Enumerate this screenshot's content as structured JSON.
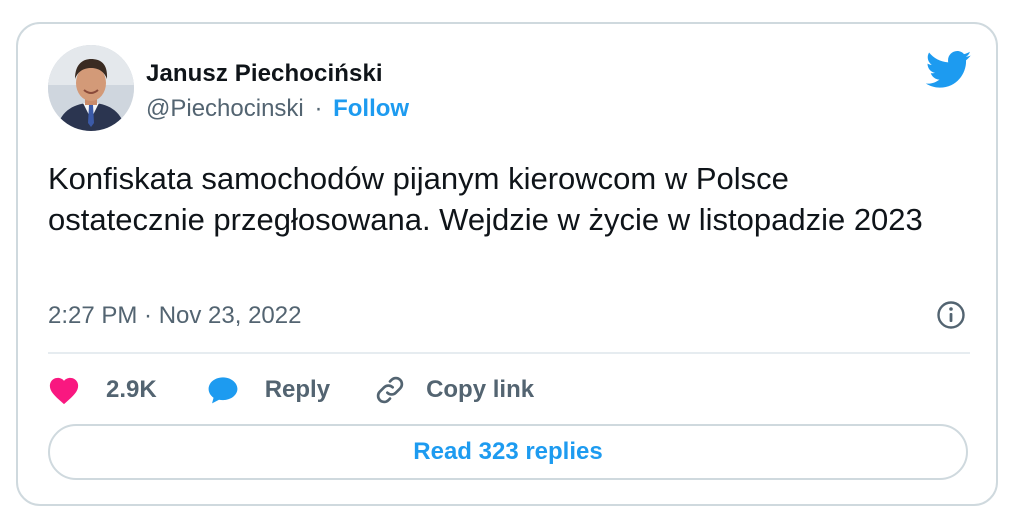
{
  "author": {
    "name": "Janusz Piechociński",
    "handle": "@Piechocinski",
    "separator": "·",
    "follow_label": "Follow"
  },
  "tweet": {
    "text": "Konfiskata samochodów pijanym kierowcom w Polsce ostatecznie przegłosowana. Wejdzie w życie w listopadzie 2023",
    "timestamp": "2:27 PM · Nov 23, 2022"
  },
  "actions": {
    "likes": "2.9K",
    "reply_label": "Reply",
    "copy_link_label": "Copy link"
  },
  "read_replies_label": "Read 323 replies",
  "icons": {
    "brand": "twitter-bird-icon",
    "info": "info-icon",
    "like": "heart-icon",
    "reply": "speech-bubble-icon",
    "copy": "link-icon"
  },
  "colors": {
    "accent": "#1d9bf0",
    "like": "#f91880",
    "text": "#0f1419",
    "muted": "#536471",
    "border": "#cfd9de"
  }
}
